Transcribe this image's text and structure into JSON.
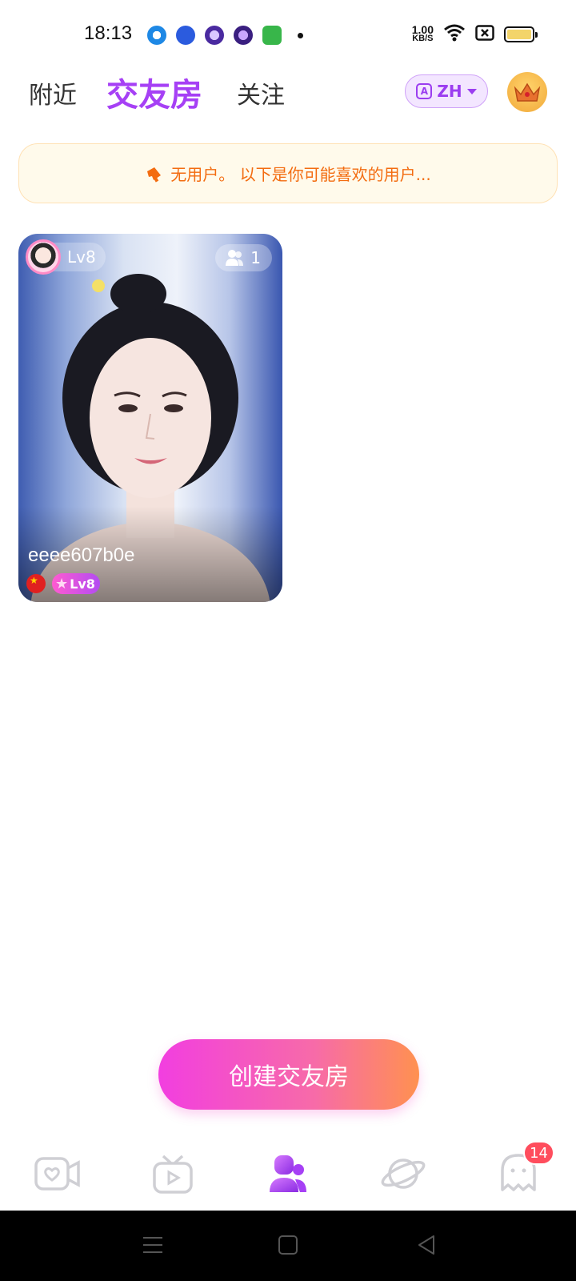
{
  "status_bar": {
    "time": "18:13",
    "net_speed_value": "1.00",
    "net_speed_unit": "KB/S",
    "icons": [
      "circle-app-icon",
      "baidu-icon",
      "purple-app-icon",
      "purple-app-icon-2",
      "green-app-icon",
      "wifi-icon",
      "sim-x-icon",
      "battery-icon"
    ]
  },
  "top_nav": {
    "tabs": [
      {
        "label": "附近"
      },
      {
        "label": "交友房"
      },
      {
        "label": "关注"
      }
    ],
    "language_label": "ZH",
    "language_icon_letter": "A"
  },
  "notice": {
    "text": "无用户。 以下是你可能喜欢的用户..."
  },
  "room_card": {
    "host_level": "Lv8",
    "viewer_count": "1",
    "username": "eeee607b0e",
    "user_level": "Lv8"
  },
  "create_button": {
    "label": "创建交友房"
  },
  "bottom_nav": {
    "items": [
      {
        "icon": "video-chat-icon"
      },
      {
        "icon": "tv-icon"
      },
      {
        "icon": "friends-room-icon"
      },
      {
        "icon": "planet-icon"
      },
      {
        "icon": "ghost-message-icon",
        "badge": "14"
      }
    ]
  },
  "colors": {
    "accent": "#a640f5",
    "notice_text": "#f36c10",
    "badge_red": "#ff4d5d"
  }
}
